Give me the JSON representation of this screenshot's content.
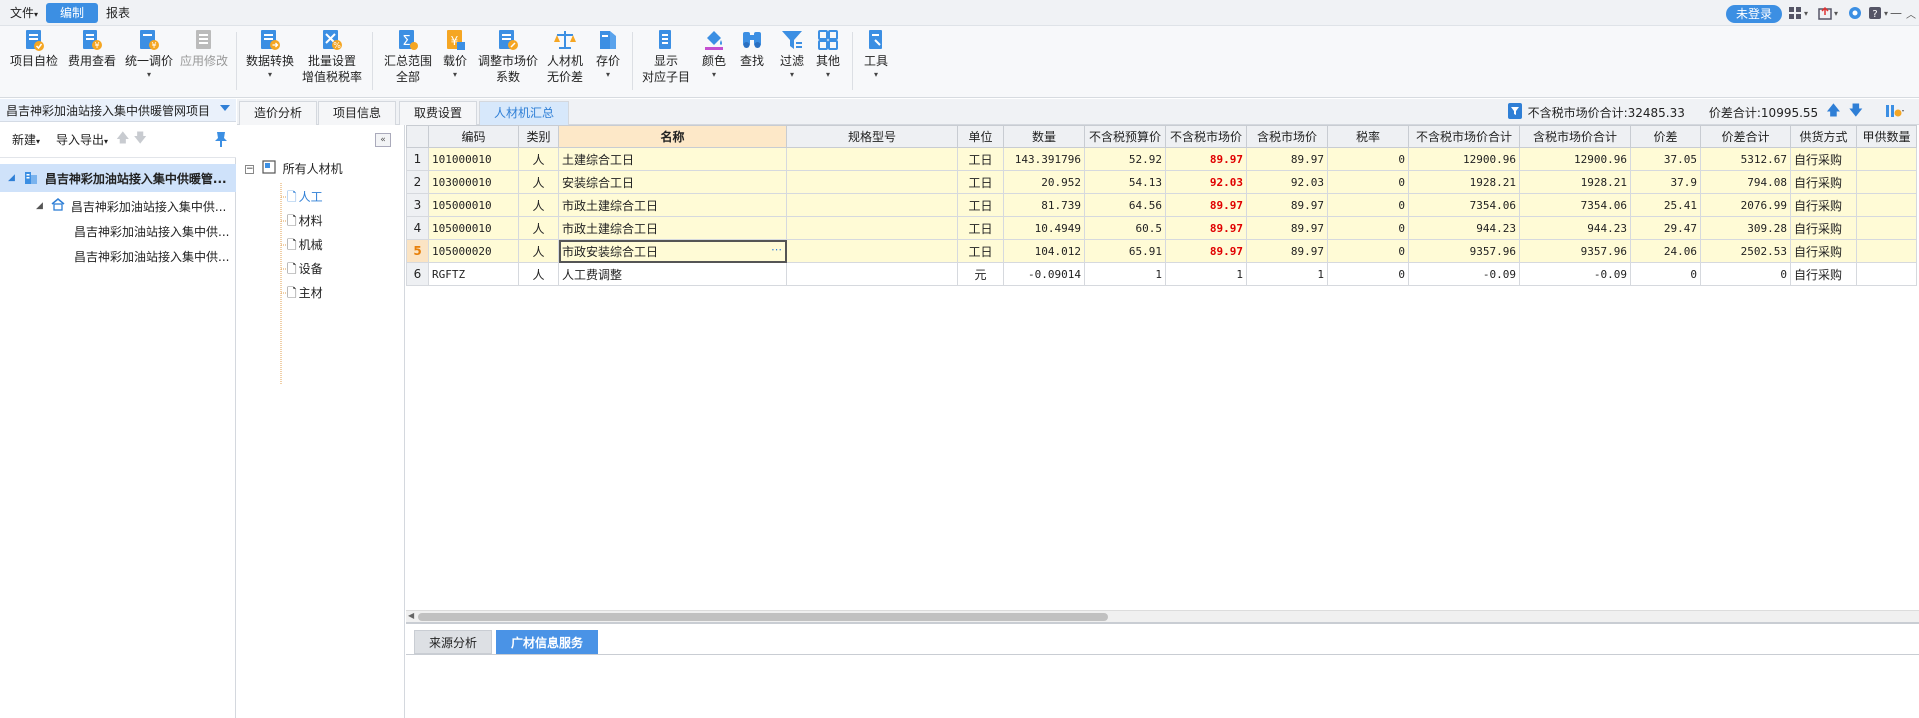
{
  "menubar": {
    "items": [
      "文件",
      "编制",
      "报表"
    ],
    "login": "未登录"
  },
  "ribbon": {
    "buttons": [
      {
        "line1": "项目自检",
        "line2": "",
        "caret": false
      },
      {
        "line1": "费用查看",
        "line2": "",
        "caret": false
      },
      {
        "line1": "统一调价",
        "line2": "",
        "caret": true
      },
      {
        "line1": "应用修改",
        "line2": "",
        "caret": false
      },
      {
        "line1": "数据转换",
        "line2": "",
        "caret": true
      },
      {
        "line1": "批量设置",
        "line2": "增值税税率",
        "caret": false
      },
      {
        "line1": "汇总范围",
        "line2": "全部",
        "caret": false
      },
      {
        "line1": "载价",
        "line2": "",
        "caret": true
      },
      {
        "line1": "调整市场价",
        "line2": "系数",
        "caret": false
      },
      {
        "line1": "人材机",
        "line2": "无价差",
        "caret": false
      },
      {
        "line1": "存价",
        "line2": "",
        "caret": true
      },
      {
        "line1": "显示",
        "line2": "对应子目",
        "caret": false
      },
      {
        "line1": "颜色",
        "line2": "",
        "caret": true
      },
      {
        "line1": "查找",
        "line2": "",
        "caret": false
      },
      {
        "line1": "过滤",
        "line2": "",
        "caret": true
      },
      {
        "line1": "其他",
        "line2": "",
        "caret": true
      },
      {
        "line1": "工具",
        "line2": "",
        "caret": true
      }
    ]
  },
  "project": {
    "header": "昌吉神彩加油站接入集中供暖管网项目",
    "new_label": "新建",
    "import_export_label": "导入导出",
    "tree": [
      {
        "label": "昌吉神彩加油站接入集中供暖管...",
        "level": 0
      },
      {
        "label": "昌吉神彩加油站接入集中供...",
        "level": 1
      },
      {
        "label": "昌吉神彩加油站接入集中供...",
        "level": 2
      },
      {
        "label": "昌吉神彩加油站接入集中供...",
        "level": 2
      }
    ]
  },
  "tabs": [
    "造价分析",
    "项目信息",
    "取费设置",
    "人材机汇总"
  ],
  "totals": {
    "market_total": "不含税市场价合计:32485.33",
    "diff_total": "价差合计:10995.55"
  },
  "categories": {
    "root": "所有人材机",
    "children": [
      "人工",
      "材料",
      "机械",
      "设备",
      "主材"
    ]
  },
  "grid": {
    "headers": [
      "编码",
      "类别",
      "名称",
      "规格型号",
      "单位",
      "数量",
      "不含税预算价",
      "不含税市场价",
      "含税市场价",
      "税率",
      "不含税市场价合计",
      "含税市场价合计",
      "价差",
      "价差合计",
      "供货方式",
      "甲供数量"
    ],
    "rows": [
      {
        "no": "1",
        "code": "101000010",
        "type": "人",
        "name": "土建综合工日",
        "spec": "",
        "unit": "工日",
        "qty": "143.391796",
        "budget": "52.92",
        "market": "89.97",
        "taxmarket": "89.97",
        "rate": "0",
        "mtotal": "12900.96",
        "tmtotal": "12900.96",
        "diff": "37.05",
        "difftotal": "5312.67",
        "supply": "自行采购",
        "aqty": ""
      },
      {
        "no": "2",
        "code": "103000010",
        "type": "人",
        "name": "安装综合工日",
        "spec": "",
        "unit": "工日",
        "qty": "20.952",
        "budget": "54.13",
        "market": "92.03",
        "taxmarket": "92.03",
        "rate": "0",
        "mtotal": "1928.21",
        "tmtotal": "1928.21",
        "diff": "37.9",
        "difftotal": "794.08",
        "supply": "自行采购",
        "aqty": ""
      },
      {
        "no": "3",
        "code": "105000010",
        "type": "人",
        "name": "市政土建综合工日",
        "spec": "",
        "unit": "工日",
        "qty": "81.739",
        "budget": "64.56",
        "market": "89.97",
        "taxmarket": "89.97",
        "rate": "0",
        "mtotal": "7354.06",
        "tmtotal": "7354.06",
        "diff": "25.41",
        "difftotal": "2076.99",
        "supply": "自行采购",
        "aqty": ""
      },
      {
        "no": "4",
        "code": "105000010",
        "type": "人",
        "name": "市政土建综合工日",
        "spec": "",
        "unit": "工日",
        "qty": "10.4949",
        "budget": "60.5",
        "market": "89.97",
        "taxmarket": "89.97",
        "rate": "0",
        "mtotal": "944.23",
        "tmtotal": "944.23",
        "diff": "29.47",
        "difftotal": "309.28",
        "supply": "自行采购",
        "aqty": ""
      },
      {
        "no": "5",
        "code": "105000020",
        "type": "人",
        "name": "市政安装综合工日",
        "spec": "",
        "unit": "工日",
        "qty": "104.012",
        "budget": "65.91",
        "market": "89.97",
        "taxmarket": "89.97",
        "rate": "0",
        "mtotal": "9357.96",
        "tmtotal": "9357.96",
        "diff": "24.06",
        "difftotal": "2502.53",
        "supply": "自行采购",
        "aqty": ""
      },
      {
        "no": "6",
        "code": "RGFTZ",
        "type": "人",
        "name": "人工费调整",
        "spec": "",
        "unit": "元",
        "qty": "-0.09014",
        "budget": "1",
        "market": "1",
        "taxmarket": "1",
        "rate": "0",
        "mtotal": "-0.09",
        "tmtotal": "-0.09",
        "diff": "0",
        "difftotal": "0",
        "supply": "自行采购",
        "aqty": ""
      }
    ]
  },
  "bottom": {
    "tabs": [
      "来源分析",
      "广材信息服务"
    ]
  },
  "colors": {
    "accent": "#3c8fe3",
    "highlight_row": "#fffbd6",
    "red_value": "#e00000"
  }
}
